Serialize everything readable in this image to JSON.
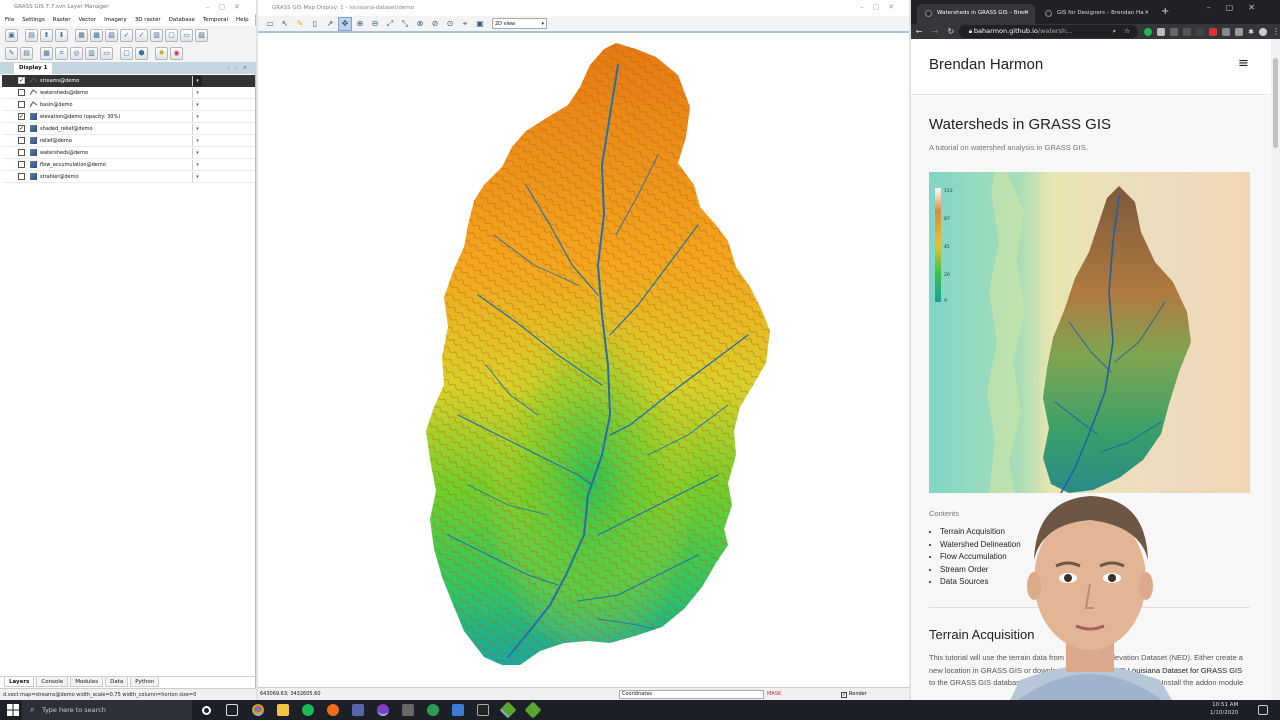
{
  "layer_manager": {
    "title": "GRASS GIS 7.7.svn Layer Manager",
    "menu": [
      "File",
      "Settings",
      "Raster",
      "Vector",
      "Imagery",
      "3D raster",
      "Database",
      "Temporal",
      "Help"
    ],
    "display_tab": "Display 1",
    "tab_nav": "‹ › ×",
    "layers": [
      {
        "name": "streams@demo",
        "checked": true,
        "type": "vector",
        "selected": true
      },
      {
        "name": "watersheds@demo",
        "checked": false,
        "type": "vector"
      },
      {
        "name": "basin@demo",
        "checked": false,
        "type": "vector"
      },
      {
        "name": "elevation@demo (opacity: 30%)",
        "checked": true,
        "type": "raster"
      },
      {
        "name": "shaded_relief@demo",
        "checked": true,
        "type": "raster"
      },
      {
        "name": "relief@demo",
        "checked": false,
        "type": "raster"
      },
      {
        "name": "watersheds@demo",
        "checked": false,
        "type": "raster"
      },
      {
        "name": "flow_accumulation@demo",
        "checked": false,
        "type": "raster"
      },
      {
        "name": "strahler@demo",
        "checked": false,
        "type": "raster"
      }
    ],
    "bottom_tabs": [
      "Layers",
      "Console",
      "Modules",
      "Data",
      "Python"
    ],
    "status": "d.vect map=streams@demo width_scale=0.75 width_column=horton size=0"
  },
  "map_display": {
    "title": "GRASS GIS Map Display: 1 - louisiana-dataset/demo",
    "view_mode": "2D view",
    "coordinates": "643069.63; 3432605.60",
    "coord_mode": "Coordinates",
    "mask": "MASK",
    "render_label": "Render",
    "render_checked": true
  },
  "browser": {
    "tabs": [
      {
        "title": "Watersheds in GRASS GIS – Bren",
        "active": true
      },
      {
        "title": "GIS for Designers – Brendan Ha",
        "active": false
      }
    ],
    "url_host": "baharmon.github.io",
    "url_path": "/watersh...",
    "site_name": "Brendan Harmon",
    "post_title": "Watersheds in GRASS GIS",
    "post_subtitle": "A tutorial on watershed analysis in GRASS GIS.",
    "legend_ticks": [
      "153",
      "87",
      "45",
      "26",
      "9"
    ],
    "contents_heading": "Contents",
    "toc": [
      "Terrain Acquisition",
      "Watershed Delineation",
      "Flow Accumulation",
      "Stream Order",
      "Data Sources"
    ],
    "section_heading": "Terrain Acquisition",
    "section_text_1": "This tutorial will use the terrain data from the National Elevation Dataset (NED). Either create a new location in GRASS GIS or download and extract the",
    "section_link": "Louisiana Dataset for GRASS GIS",
    "section_text_2": "to the GRASS GIS database directory, and create or select a mapset. Install the addon module"
  },
  "taskbar": {
    "search_placeholder": "Type here to search",
    "time": "10:51 AM",
    "date": "1/10/2020"
  }
}
